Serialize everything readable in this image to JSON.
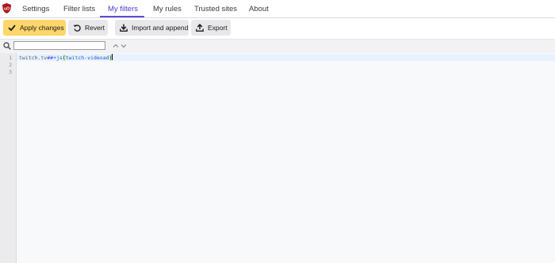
{
  "tabs": [
    {
      "label": "Settings"
    },
    {
      "label": "Filter lists"
    },
    {
      "label": "My filters",
      "active": true
    },
    {
      "label": "My rules"
    },
    {
      "label": "Trusted sites"
    },
    {
      "label": "About"
    }
  ],
  "toolbar": {
    "apply_label": "Apply changes",
    "revert_label": "Revert",
    "import_label": "Import and append",
    "export_label": "Export"
  },
  "search": {
    "value": "",
    "placeholder": ""
  },
  "editor": {
    "line_numbers": [
      "1",
      "2",
      "3"
    ],
    "line1": {
      "domain": "twitch.tv",
      "separator": "##",
      "scriptlet_prefix": "+js",
      "open_paren": "(",
      "argument": "twitch-videoad",
      "close_paren": ")"
    }
  },
  "colors": {
    "accent": "#5a4fd6",
    "primary_button": "#ffd66b",
    "button": "#e8e8eb",
    "logo": "#b1131a"
  }
}
